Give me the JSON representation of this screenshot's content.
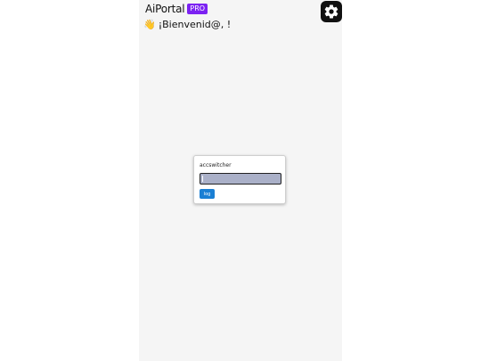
{
  "header": {
    "brand": "AiPortal",
    "badge": "PRO",
    "settings_icon": "gear-icon"
  },
  "welcome": {
    "icon": "wave-hand-icon",
    "glyph": "👋",
    "text": "¡Bienvenid@, !"
  },
  "panel": {
    "title": "accswitcher",
    "input_value": "",
    "button_label": "log"
  },
  "colors": {
    "badge_bg": "#7c22f2",
    "button_bg": "#1a7fd4",
    "input_bg": "#aab0c8",
    "page_bg": "#f5f5f5"
  }
}
